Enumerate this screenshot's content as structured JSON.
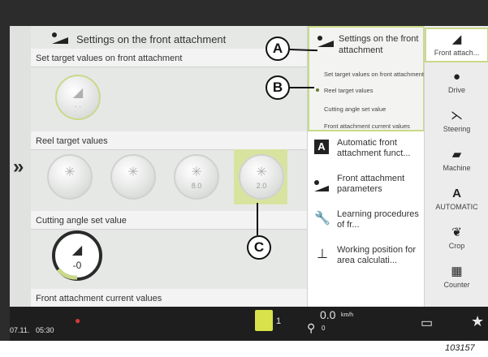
{
  "main": {
    "title": "Settings on the front attachment",
    "sections": {
      "set_target": {
        "label": "Set target values on front attachment"
      },
      "reel": {
        "label": "Reel target values",
        "knob_values": [
          "",
          "",
          "8.0",
          "2.0"
        ]
      },
      "cutting": {
        "label": "Cutting angle set value",
        "value": "-0"
      },
      "current": {
        "label": "Front attachment current values"
      }
    }
  },
  "submenu": {
    "title": "Settings on the front attachment",
    "items": [
      {
        "label": "Set target values on front attachment"
      },
      {
        "label": "Reel target values"
      },
      {
        "label": "Cutting angle set value"
      },
      {
        "label": "Front attachment current values"
      }
    ],
    "menu": [
      {
        "label": "Automatic front attachment funct...",
        "icon": "automatic-a-icon"
      },
      {
        "label": "Front attachment parameters",
        "icon": "header-icon"
      },
      {
        "label": "Learning procedures of fr...",
        "icon": "wrench-icon"
      },
      {
        "label": "Working position for area calculati...",
        "icon": "position-icon"
      }
    ]
  },
  "nav": {
    "items": [
      {
        "label": "Front attach...",
        "icon": "header-icon"
      },
      {
        "label": "Drive",
        "icon": "drive-icon"
      },
      {
        "label": "Steering",
        "icon": "steering-icon"
      },
      {
        "label": "Machine",
        "icon": "combine-icon"
      },
      {
        "label": "AUTOMATIC",
        "icon": "automatic-a-icon"
      },
      {
        "label": "Crop",
        "icon": "crop-icon"
      },
      {
        "label": "Counter",
        "icon": "counter-icon"
      }
    ]
  },
  "bottombar": {
    "date": "07.11.",
    "time": "05:30",
    "header_indicator": "1",
    "speed": "0.0",
    "speed_unit": "km/h",
    "speed_sub": "0"
  },
  "callouts": [
    "A",
    "B",
    "C"
  ],
  "figure_number": "103157",
  "colors": {
    "accent": "#c9d98a",
    "bezel": "#2c2c2c",
    "bar": "#1e1e1e"
  }
}
